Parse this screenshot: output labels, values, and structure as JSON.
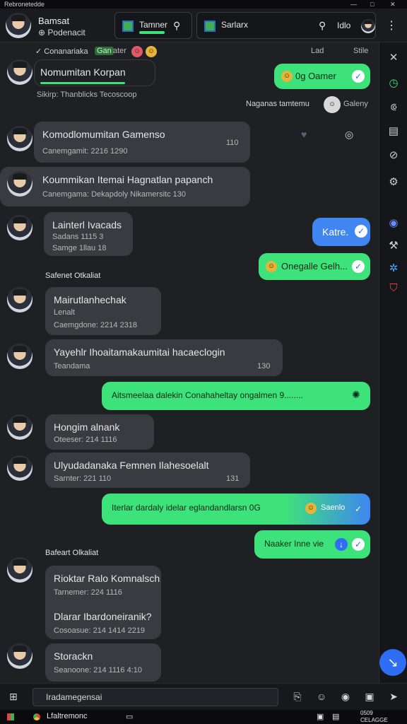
{
  "window": {
    "title": "Rebronetedde",
    "controls": [
      "—",
      "□",
      "✕"
    ]
  },
  "header": {
    "contact_name": "Bamsat",
    "contact_status": "Podenacit",
    "search_pill": {
      "label": "Tamner"
    },
    "second_pill": {
      "label": "Sarlarx"
    },
    "right_label": "Idlo"
  },
  "top_strip": {
    "left_text": "Conanariaka",
    "left_tag": "Gan",
    "left_after": "ater",
    "right_time": "Lad",
    "right_label": "Stile"
  },
  "messages": [
    {
      "id": "m1",
      "dir": "in",
      "title": "Nomumitan Korpan",
      "meta": "Sikirp: Thanblicks Tecoscoop"
    },
    {
      "id": "m2",
      "dir": "out",
      "text": "0g Oamer"
    },
    {
      "id": "m3",
      "dir": "note",
      "text": "Naganas tamtemu",
      "aside": "Galeny"
    },
    {
      "id": "m4",
      "dir": "in",
      "title": "Komodlomumitan Gamenso",
      "meta": "Canemgamit: 2216 1290",
      "time": "110"
    },
    {
      "id": "m5",
      "dir": "in",
      "title": "Koummikan Itemai Hagnatlan papanch",
      "meta": "Canemgama: Dekapdoly Nikamersitc 130"
    },
    {
      "id": "m6",
      "dir": "in",
      "title": "Lainterl Ivacads",
      "meta": "Sadans 1115 3",
      "meta2": "Samge 1llau 18"
    },
    {
      "id": "m7",
      "dir": "outblue",
      "text": "Katre."
    },
    {
      "id": "m8",
      "dir": "out",
      "text": "Onegalle Gelh..."
    },
    {
      "id": "sep1",
      "dir": "sep",
      "text": "Safenet Otkaliat"
    },
    {
      "id": "m9",
      "dir": "in",
      "title": "Mairutlanhechak",
      "sub": "Lenalt",
      "meta": "Caemgdone: 2214 2318"
    },
    {
      "id": "m10",
      "dir": "in",
      "title": "Yayehlr Ihoaitamakaumitai hacaeclogin",
      "meta": "Teandama",
      "time": "130"
    },
    {
      "id": "m11",
      "dir": "out",
      "text": "Aitsmeelaa dalekin Conahaheltay ongalmen 9........"
    },
    {
      "id": "m12",
      "dir": "in",
      "title": "Hongim alnank",
      "meta": "Oteeser: 214 1116"
    },
    {
      "id": "m13",
      "dir": "in",
      "title": "Ulyudadanaka Femnen Ilahesoelalt",
      "meta": "Sarnter: 221 110",
      "time": "131"
    },
    {
      "id": "m14",
      "dir": "outmix",
      "text": "Iterlar dardaly idelar eglandandlarsn 0G",
      "tail": "Saenlo"
    },
    {
      "id": "m15",
      "dir": "out",
      "text": "Naaker Inne vie"
    },
    {
      "id": "sep2",
      "dir": "sep",
      "text": "Bafeart Olkaliat"
    },
    {
      "id": "m16",
      "dir": "in",
      "title": "Rioktar Ralo Komnalsch",
      "meta": "Tarnemer: 224 1116",
      "title2": "Dlarar Ibardoneiranik?",
      "meta2": "Cosoasue: 214 1414 2219"
    },
    {
      "id": "m17",
      "dir": "in",
      "title": "Storackn",
      "meta": "Seanoone: 214 1116 4:10"
    }
  ],
  "composer": {
    "placeholder": "Iradamegensai"
  },
  "taskbar": {
    "app_label": "Lfaltremonc",
    "clock_time": "0509",
    "clock_date": "CELAGGE"
  },
  "colors": {
    "accent_green": "#3ee27a",
    "accent_blue": "#2f6df5",
    "incoming_bubble": "#3a3b41",
    "background": "#1f2024"
  },
  "icons": [
    "search-icon",
    "close-icon",
    "timer-icon",
    "crop-icon",
    "layout-icon",
    "compass-icon",
    "settings-icon",
    "circle-icon",
    "tools-icon",
    "puzzle-icon",
    "shield-icon",
    "check-icon",
    "windows-icon",
    "attach-icon",
    "emoji-icon",
    "mic-icon",
    "gallery-icon",
    "send-icon",
    "chrome-icon"
  ]
}
